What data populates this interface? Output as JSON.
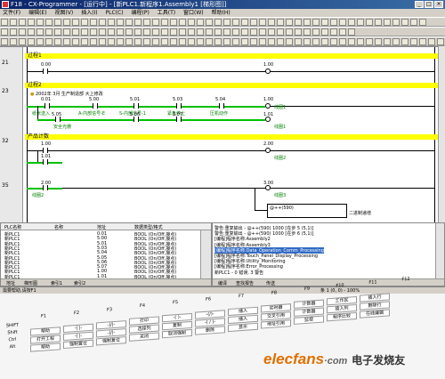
{
  "window": {
    "title": "F18 - CX-Programmer - [运行中] - [新PLC1.新程序1.Assembly1 [梯形图]]"
  },
  "menu": [
    "文件(F)",
    "编辑(E)",
    "视图(V)",
    "插入(I)",
    "PLC(C)",
    "编程(P)",
    "工具(T)",
    "窗口(W)",
    "帮助(H)"
  ],
  "rungs": [
    {
      "num": "21",
      "comment": "过程1",
      "contact": "0.00",
      "coil": "1.00"
    },
    {
      "num": "23",
      "comment": "过程2",
      "note": "2002年 3月 生产制造部 大上修改",
      "contacts": [
        {
          "addr": "0.01",
          "name": "纸张送入"
        },
        {
          "addr": "5.00",
          "name": "A-内部信号-E"
        },
        {
          "addr": "5.01",
          "name": "S-内部信号-1"
        },
        {
          "addr": "5.03",
          "name": "紧急停止"
        },
        {
          "addr": "5.04",
          "name": "压机动作"
        }
      ],
      "branch": [
        {
          "addr": "5.05",
          "name": "安全光栅"
        },
        {
          "addr": "5.06",
          "name": ""
        },
        {
          "addr": "5.07",
          "name": ""
        }
      ],
      "coil": "1.00",
      "coil_label": "线圈1",
      "coil2": "1.01",
      "coil2_label": "线圈1"
    },
    {
      "num": "32",
      "comment": "产品计数",
      "contact": "1.00",
      "coil": "2.00",
      "coil_label": "线圈2",
      "branch": "1.01"
    },
    {
      "num": "35",
      "comment": "",
      "contact": "2.00",
      "contact_label": "线圈2",
      "coil": "3.00",
      "coil_label": "线圈3",
      "instr": "@++(590)",
      "instr_label": "二进制递增"
    }
  ],
  "symbol_table": {
    "headers": [
      "PLC名称",
      "名称",
      "地址",
      "数据类型/格式"
    ],
    "rows": [
      [
        "新PLC1",
        "",
        "0.01",
        "BOOL (On/Off,接点)"
      ],
      [
        "新PLC1",
        "",
        "5.00",
        "BOOL (On/Off,接点)"
      ],
      [
        "新PLC1",
        "",
        "5.01",
        "BOOL (On/Off,接点)"
      ],
      [
        "新PLC1",
        "",
        "5.03",
        "BOOL (On/Off,接点)"
      ],
      [
        "新PLC1",
        "",
        "5.04",
        "BOOL (On/Off,接点)"
      ],
      [
        "新PLC1",
        "",
        "5.05",
        "BOOL (On/Off,接点)"
      ],
      [
        "新PLC1",
        "",
        "5.06",
        "BOOL (On/Off,接点)"
      ],
      [
        "新PLC1",
        "",
        "5.07",
        "BOOL (On/Off,接点)"
      ],
      [
        "新PLC1",
        "",
        "1.00",
        "BOOL (On/Off,接点)"
      ],
      [
        "新PLC1",
        "",
        "1.01",
        "BOOL (On/Off,接点)"
      ]
    ],
    "tabs": [
      "地址",
      "梯形图",
      "索引1",
      "索引2"
    ]
  },
  "output": {
    "lines": [
      "警告:重复输出 - @++(590) 1000 [在步 5 (5,1)]",
      "警告:重复输出 - @++(590) 1000 [在步 6 (5,1)]",
      "[编程]程序名称:Assembly2",
      "[编程]程序名称:Assembly3",
      "[编程]程序名称:Data_Operation_Comm_Processing",
      "[编程]程序名称:Touch_Panel_Display_Processing",
      "[编程]程序名称:Utility_Monitoring",
      "[编程]程序名称:Error_Processing",
      "新PLC1 - 0 错误, 3 警告"
    ],
    "selected": 4,
    "tabs": [
      "编译",
      "查找报告",
      "传送"
    ]
  },
  "status": {
    "help": "需要帮助,请按F1",
    "pos": "条 1 (0, 0) - 100%"
  },
  "keyboard": {
    "fkeys": [
      "F1",
      "F2",
      "F3",
      "F4",
      "F5",
      "F6",
      "F7",
      "F8",
      "F9",
      "F10",
      "F11",
      "F12"
    ],
    "mods": [
      "SHIFT",
      "Shift",
      "Ctrl",
      "Alt"
    ],
    "row1": [
      "帮助",
      "-|  |-",
      "-|/|-",
      "打印",
      "-( )-",
      "-(/)-",
      "插入",
      "实时器",
      "计数器",
      "工作区",
      "插入行"
    ],
    "row2": [
      "打开工程",
      "-|  |-",
      "-|/|-",
      "选择列",
      "复制",
      "-( / )-",
      "插入",
      "交叉引用",
      "计数器",
      "插入列",
      "删除行"
    ],
    "row3": [
      "帮助",
      "强制置位",
      "强制复位",
      "关闭",
      "取消强制",
      "删除",
      "显示",
      "地址引用",
      "监视",
      "程序比较",
      "在线编辑"
    ]
  },
  "watermark": {
    "text1": "elecfans",
    "text2": "·com",
    "text3": "电子发烧友"
  }
}
